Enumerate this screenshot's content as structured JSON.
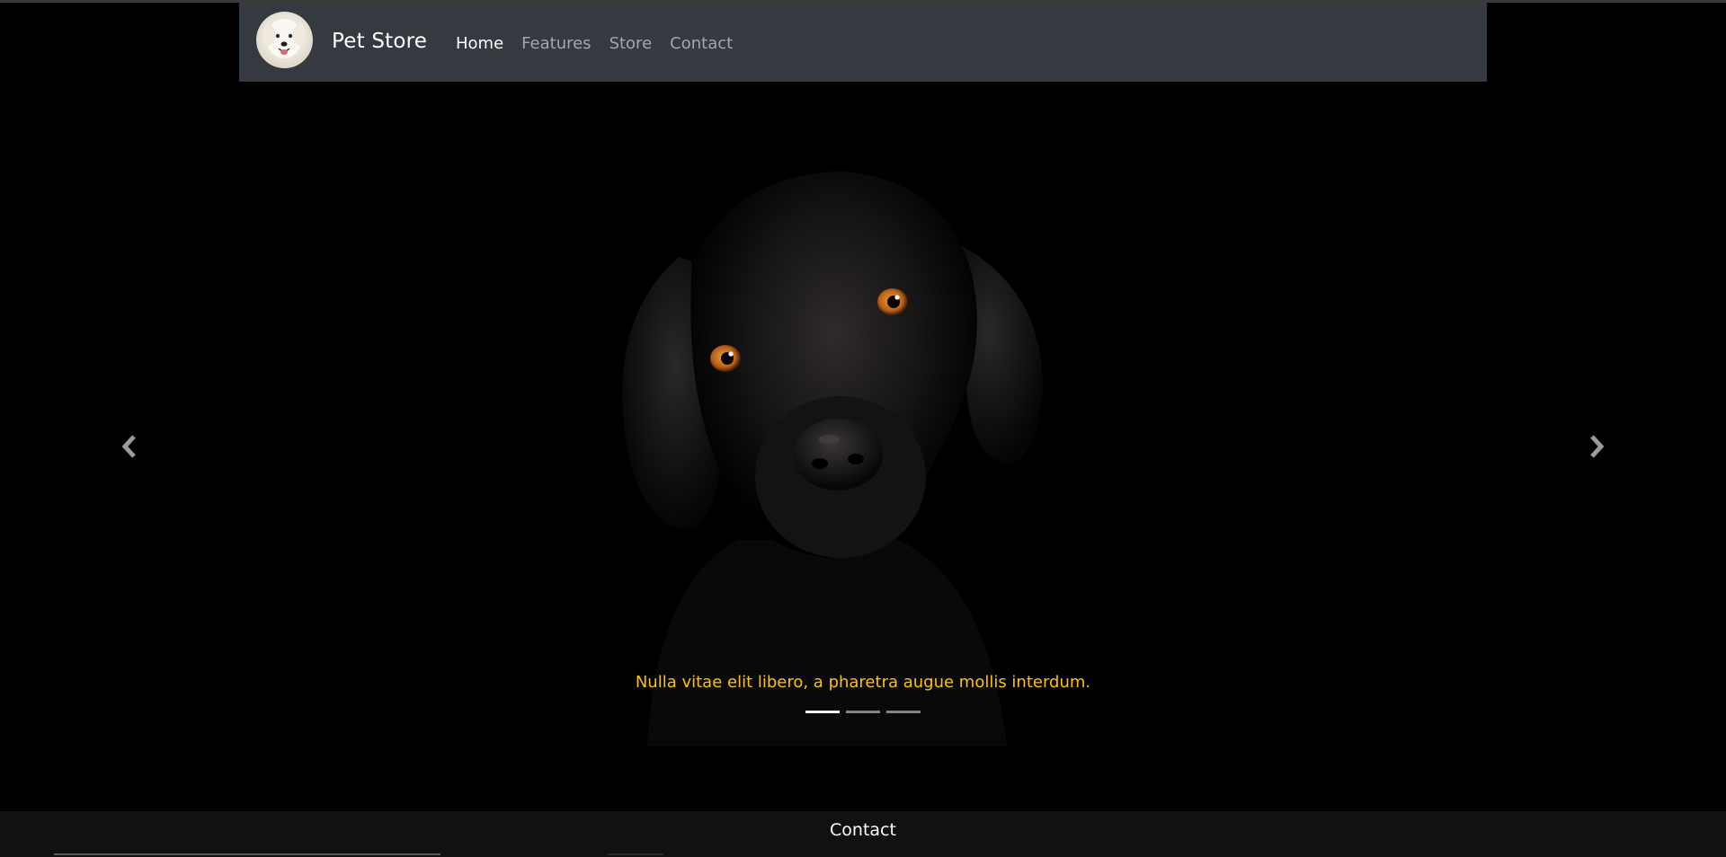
{
  "navbar": {
    "brand": "Pet Store",
    "logo_icon": "dog-logo-icon",
    "links": [
      {
        "label": "Home",
        "active": true
      },
      {
        "label": "Features",
        "active": false
      },
      {
        "label": "Store",
        "active": false
      },
      {
        "label": "Contact",
        "active": false
      }
    ]
  },
  "carousel": {
    "caption": "Nulla vitae elit libero, a pharetra augue mollis interdum.",
    "prev_icon": "chevron-left-icon",
    "next_icon": "chevron-right-icon",
    "slide_count": 3,
    "active_slide": 1,
    "caption_color": "#ffc107"
  },
  "footer": {
    "title": "Contact"
  },
  "colors": {
    "navbar_bg": "#343a40",
    "page_bg": "#000000",
    "footer_bg": "#111111"
  }
}
